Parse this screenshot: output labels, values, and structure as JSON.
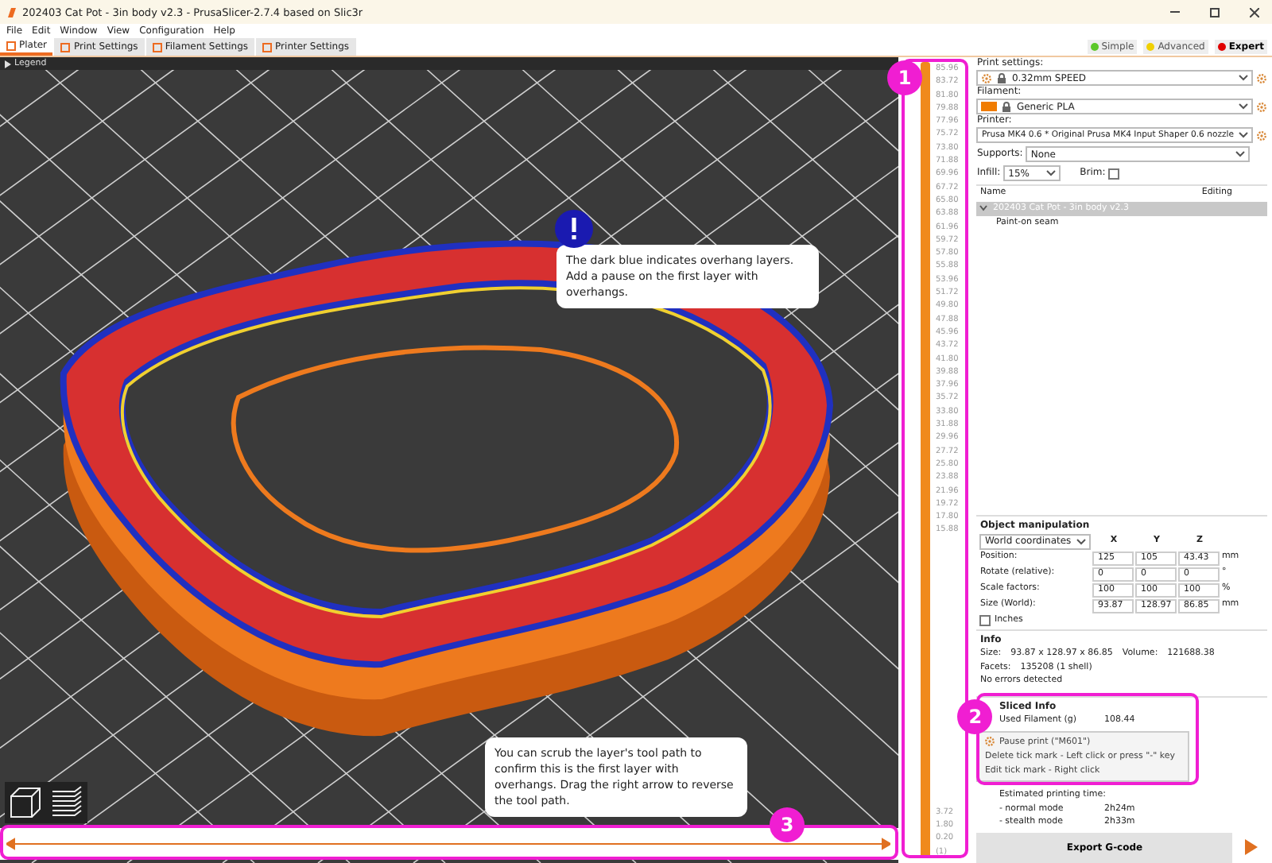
{
  "window": {
    "title": "202403 Cat Pot - 3in body v2.3 - PrusaSlicer-2.7.4 based on Slic3r"
  },
  "menu": [
    "File",
    "Edit",
    "Window",
    "View",
    "Configuration",
    "Help"
  ],
  "tabs": [
    {
      "label": "Plater",
      "selected": true
    },
    {
      "label": "Print Settings",
      "selected": false
    },
    {
      "label": "Filament Settings",
      "selected": false
    },
    {
      "label": "Printer Settings",
      "selected": false
    }
  ],
  "modes": [
    {
      "label": "Simple",
      "color": "#5cc82a",
      "selected": false
    },
    {
      "label": "Advanced",
      "color": "#f0d000",
      "selected": false
    },
    {
      "label": "Expert",
      "color": "#e00000",
      "selected": true
    }
  ],
  "legend": {
    "label": "Legend"
  },
  "callouts": [
    {
      "kind": "alert",
      "text": "The dark blue indicates overhang layers. Add a pause on the first layer with overhangs."
    },
    {
      "kind": "plain",
      "text": "You can scrub the layer's tool path to confirm this is the first layer with overhangs. Drag the right arrow to reverse the tool path."
    }
  ],
  "badges": [
    "1",
    "2",
    "3"
  ],
  "horizontal_slider": {
    "level": 1
  },
  "layer_slider": {
    "level": 1,
    "ticks": [
      "85.96",
      "83.72",
      "81.80",
      "79.88",
      "77.96",
      "75.72",
      "73.80",
      "71.88",
      "69.96",
      "67.72",
      "65.80",
      "63.88",
      "61.96",
      "59.72",
      "57.80",
      "55.88",
      "53.96",
      "51.72",
      "49.80",
      "47.88",
      "45.96",
      "43.72",
      "41.80",
      "39.88",
      "37.96",
      "35.72",
      "33.80",
      "31.88",
      "29.96",
      "27.72",
      "25.80",
      "23.88",
      "21.96",
      "19.72",
      "17.80",
      "15.88"
    ],
    "bottom_ticks": [
      "3.72",
      "1.80",
      "0.20",
      "(1)"
    ]
  },
  "tick_popup": {
    "items": [
      "Pause print (\"M601\")",
      "Delete tick mark - Left click or press \"-\" key",
      "Edit tick mark - Right click"
    ]
  },
  "sidebar": {
    "print_label": "Print settings:",
    "print_value": "0.32mm SPEED",
    "filament_label": "Filament:",
    "filaments": [
      {
        "name": "Generic PLA",
        "color": "#f07c00"
      }
    ],
    "printer_label": "Printer:",
    "printer_value": "Prusa MK4 0.6 * Original Prusa MK4 Input Shaper 0.6 nozzle",
    "supports_label": "Supports:",
    "supports_value": "None",
    "infill_label": "Infill:",
    "infill_value": "15%",
    "brim_label": "Brim:",
    "brim_checked": false,
    "object_list": {
      "columns": [
        "Name",
        "Editing"
      ],
      "object": "202403 Cat Pot - 3in body v2.3",
      "expanded": true,
      "children": [
        "Paint-on seam"
      ]
    },
    "manipulation": {
      "title": "Object manipulation",
      "coords": "World coordinates",
      "axes": [
        "X",
        "Y",
        "Z"
      ],
      "rows": [
        {
          "label": "Position:",
          "values": [
            "125",
            "105",
            "43.43"
          ],
          "unit": "mm"
        },
        {
          "label": "Rotate (relative):",
          "values": [
            "0",
            "0",
            "0"
          ],
          "unit": "°"
        },
        {
          "label": "Scale factors:",
          "values": [
            "100",
            "100",
            "100"
          ],
          "unit": "%"
        },
        {
          "label": "Size (World):",
          "values": [
            "93.87",
            "128.97",
            "86.85"
          ],
          "unit": "mm"
        }
      ],
      "inches_label": "Inches",
      "inches_checked": false
    },
    "info": {
      "title": "Info",
      "size_label": "Size:",
      "size": "93.87 x 128.97 x 86.85",
      "volume_label": "Volume:",
      "volume": "121688.38",
      "facets_label": "Facets:",
      "facets": "135208 (1 shell)",
      "errors": "No errors detected"
    },
    "sliced": {
      "title": "Sliced Info",
      "filament_label": "Used Filament (g)",
      "filament": "108.44",
      "time_label": "Estimated printing time:",
      "times": [
        {
          "label": "- normal mode",
          "value": "2h24m"
        },
        {
          "label": "- stealth mode",
          "value": "2h33m"
        }
      ]
    },
    "export": "Export G-code"
  }
}
